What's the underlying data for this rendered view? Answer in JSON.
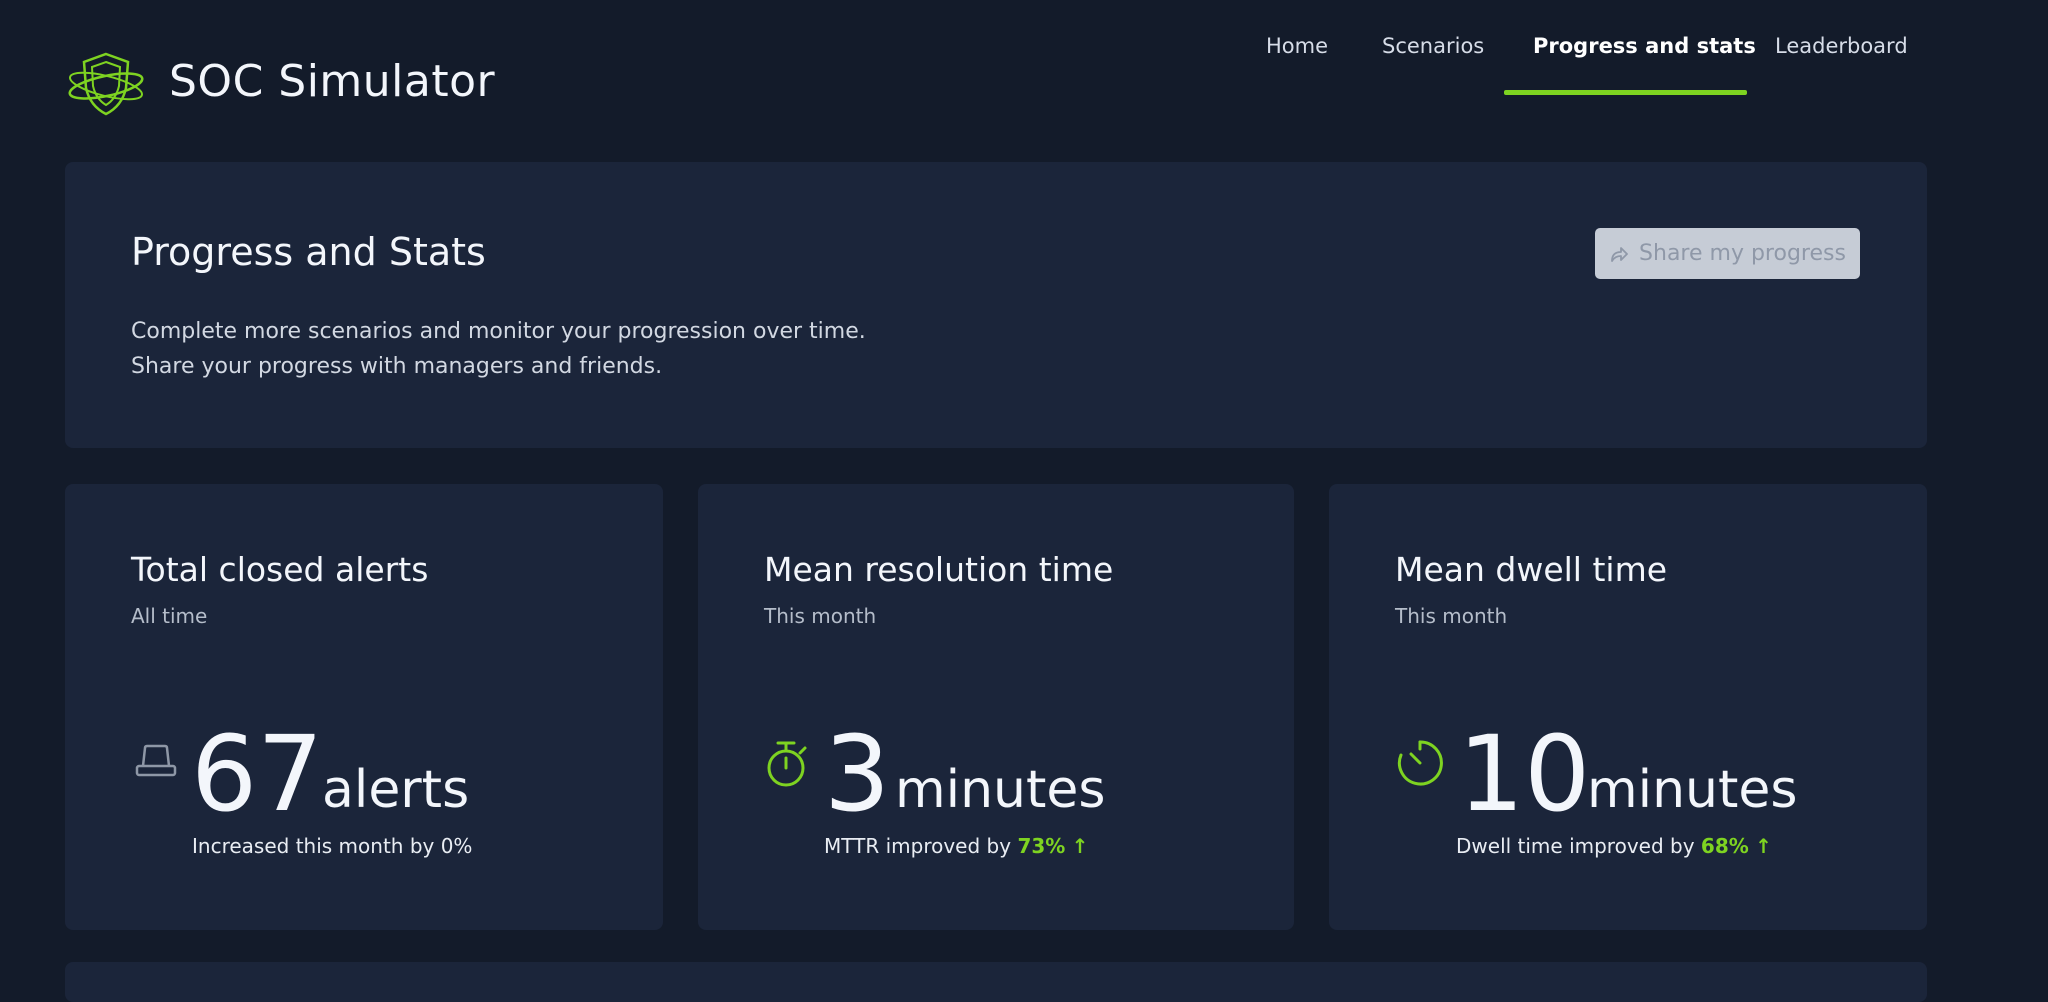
{
  "brand": {
    "title": "SOC Simulator",
    "logo_icon": "shield-orbit-icon"
  },
  "nav": {
    "items": [
      {
        "label": "Home",
        "active": false
      },
      {
        "label": "Scenarios",
        "active": false
      },
      {
        "label": "Progress and stats",
        "active": true
      },
      {
        "label": "Leaderboard",
        "active": false
      }
    ]
  },
  "hero": {
    "title": "Progress and Stats",
    "desc_line1": "Complete more scenarios and monitor your progression over time.",
    "desc_line2": "Share your progress with managers and friends.",
    "share_label": "Share my progress",
    "share_icon": "share-arrow-icon"
  },
  "stats": [
    {
      "title": "Total closed alerts",
      "subtitle": "All time",
      "icon": "siren-icon",
      "value": "67",
      "unit": "alerts",
      "note_prefix": "Increased this month by",
      "note_pct": "0%"
    },
    {
      "title": "Mean resolution time",
      "subtitle": "This month",
      "icon": "stopwatch-icon",
      "value": "3",
      "unit": "minutes",
      "note_prefix": "MTTR improved by",
      "note_pct": "73%"
    },
    {
      "title": "Mean dwell time",
      "subtitle": "This month",
      "icon": "timer-icon",
      "value": "10",
      "unit": "minutes",
      "note_prefix": "Dwell time improved by",
      "note_pct": "68%"
    }
  ],
  "colors": {
    "background": "#131b2a",
    "card": "#1b253a",
    "accent": "#7ed321",
    "button": "#c6ccd6"
  }
}
